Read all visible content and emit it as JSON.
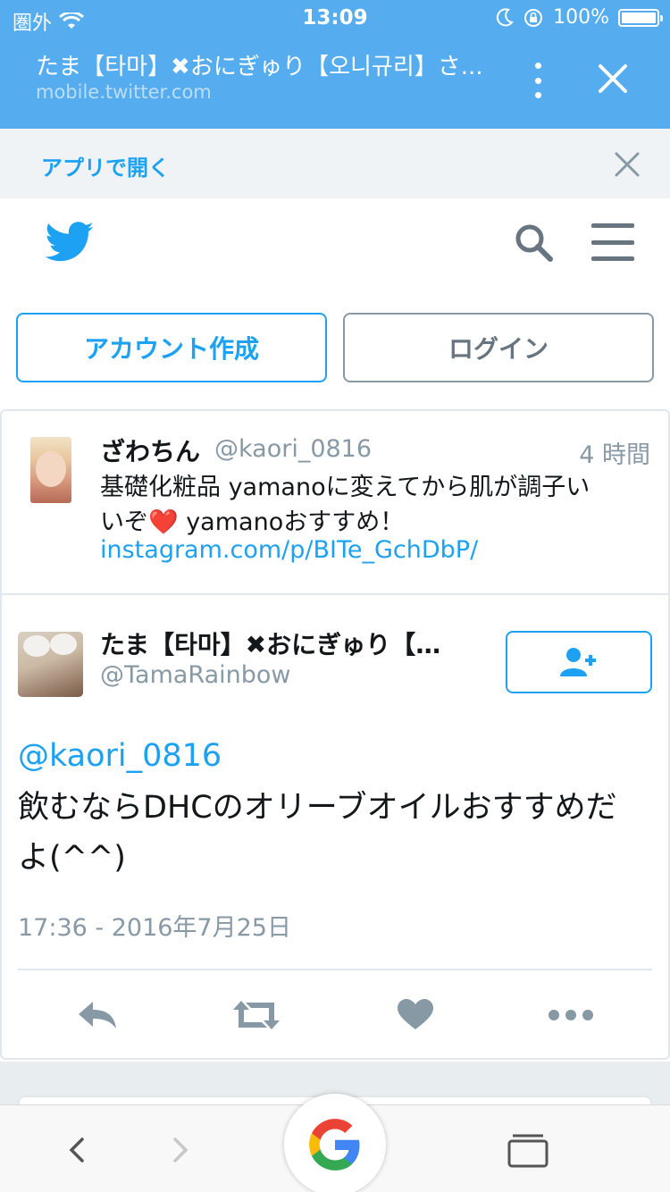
{
  "status_bar": {
    "carrier": "圏外",
    "time": "13:09",
    "battery": "100%"
  },
  "browser": {
    "page_title": "たま【타마】✖おにぎゅり【오니규리】さ...",
    "url": "mobile.twitter.com"
  },
  "app_banner": {
    "label": "アプリで開く"
  },
  "auth": {
    "signup_label": "アカウント作成",
    "login_label": "ログイン"
  },
  "parent_tweet": {
    "name": "ざわちん",
    "handle": "@kaori_0816",
    "time": "4 時間",
    "text_line1": "基礎化粧品 yamanoに変えてから肌が調子い",
    "text_line2a": "いぞ",
    "heart": "❤️",
    "text_line2b": " yamanoおすすめ！",
    "link": "instagram.com/p/BITe_GchDbP/"
  },
  "main_tweet": {
    "name": "たま【타마】✖おにぎゅり【…",
    "handle": "@TamaRainbow",
    "mention": "@kaori_0816",
    "text": "飲むならDHCのオリーブオイルおすすめだよ(^^)",
    "date": "17:36 - 2016年7月25日"
  },
  "colors": {
    "twitter_blue": "#1da1f2",
    "chrome_blue": "#55acee",
    "gray_icon": "#8899a6"
  }
}
